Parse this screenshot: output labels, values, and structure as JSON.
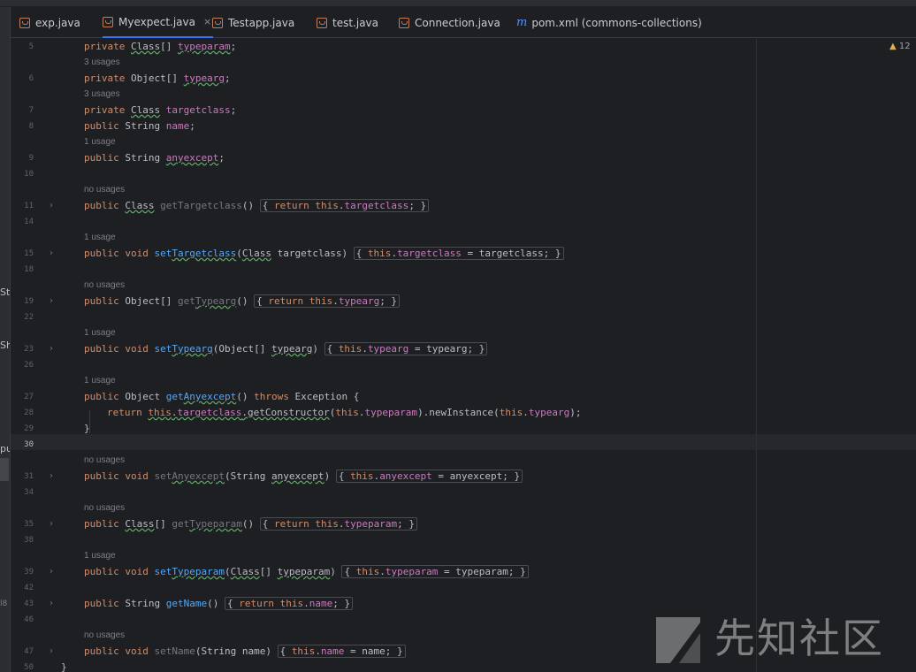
{
  "tabs": [
    {
      "label": "exp.java",
      "icon": "java-file-icon",
      "active": false
    },
    {
      "label": "Myexpect.java",
      "icon": "java-file-icon",
      "active": true,
      "close": "×"
    },
    {
      "label": "Testapp.java",
      "icon": "java-file-icon",
      "active": false
    },
    {
      "label": "test.java",
      "icon": "java-file-icon",
      "active": false
    },
    {
      "label": "Connection.java",
      "icon": "java-file-icon",
      "active": false
    },
    {
      "label": "pom.xml (commons-collections)",
      "icon": "maven-icon",
      "icon_glyph": "m",
      "active": false
    }
  ],
  "left_panel_fragments": [
    "Str",
    "Sh",
    "pu",
    "l8"
  ],
  "inspections": {
    "icon": "warning-icon",
    "count": "12"
  },
  "editor": {
    "current_line": "30",
    "lines": [
      {
        "kind": "code",
        "num": "5",
        "html": "<span class=\"kw\">private</span> <span class=\"ul\">Class</span>[] <span class=\"fld ul\">typeparam</span>;"
      },
      {
        "kind": "hint",
        "text": "3 usages"
      },
      {
        "kind": "code",
        "num": "6",
        "html": "<span class=\"kw\">private</span> Object[] <span class=\"fld ul\">typearg</span>;"
      },
      {
        "kind": "hint",
        "text": "3 usages"
      },
      {
        "kind": "code",
        "num": "7",
        "html": "<span class=\"kw\">private</span> <span class=\"ul\">Class</span> <span class=\"fld\">targetclass</span>;"
      },
      {
        "kind": "code",
        "num": "8",
        "html": "<span class=\"kw\">public</span> String <span class=\"fld\">name</span>;"
      },
      {
        "kind": "hint",
        "text": "1 usage"
      },
      {
        "kind": "code",
        "num": "9",
        "html": "<span class=\"kw\">public</span> String <span class=\"fld ul\">anyexcept</span>;"
      },
      {
        "kind": "code",
        "num": "10",
        "html": ""
      },
      {
        "kind": "hint",
        "text": "no usages"
      },
      {
        "kind": "code",
        "num": "11",
        "fold": "›",
        "html": "<span class=\"kw\">public</span> <span class=\"ul\">Class</span> <span class=\"gmth\">getTargetclass</span>() <span class=\"fb\">{ <span class=\"kw\">return this</span>.<span class=\"fld\">targetclass</span>; }</span>"
      },
      {
        "kind": "code",
        "num": "14",
        "html": ""
      },
      {
        "kind": "hint",
        "text": "1 usage"
      },
      {
        "kind": "code",
        "num": "15",
        "fold": "›",
        "html": "<span class=\"kw\">public void</span> <span class=\"mth\">set<span class=\"ul\">Targetclass</span></span>(<span class=\"ul\">Class</span> targetclass) <span class=\"fb\">{ <span class=\"kw\">this</span>.<span class=\"fld\">targetclass</span> = targetclass; }</span>"
      },
      {
        "kind": "code",
        "num": "18",
        "html": ""
      },
      {
        "kind": "hint",
        "text": "no usages"
      },
      {
        "kind": "code",
        "num": "19",
        "fold": "›",
        "html": "<span class=\"kw\">public</span> Object[] <span class=\"gmth\">get<span class=\"ul\">Typearg</span></span>() <span class=\"fb\">{ <span class=\"kw\">return this</span>.<span class=\"fld\">typearg</span>; }</span>"
      },
      {
        "kind": "code",
        "num": "22",
        "html": ""
      },
      {
        "kind": "hint",
        "text": "1 usage"
      },
      {
        "kind": "code",
        "num": "23",
        "fold": "›",
        "html": "<span class=\"kw\">public void</span> <span class=\"mth\">set<span class=\"ul\">Typearg</span></span>(Object[] <span class=\"ul\">typearg</span>) <span class=\"fb\">{ <span class=\"kw\">this</span>.<span class=\"fld\">typearg</span> = typearg; }</span>"
      },
      {
        "kind": "code",
        "num": "26",
        "html": ""
      },
      {
        "kind": "hint",
        "text": "1 usage"
      },
      {
        "kind": "code",
        "num": "27",
        "html": "<span class=\"kw\">public</span> Object <span class=\"mth\">get<span class=\"ul\">Anyexcept</span></span>() <span class=\"kw\">throws</span> Exception {"
      },
      {
        "kind": "code",
        "num": "28",
        "indent": 2,
        "html": "<span class=\"kw\">return</span> <span class=\"ul\"><span class=\"kw\">this</span>.<span class=\"fld\">targetclass</span>.getConstructor</span>(<span class=\"kw\">this</span>.<span class=\"fld\">typeparam</span>).newInstance(<span class=\"kw\">this</span>.<span class=\"fld\">typearg</span>);"
      },
      {
        "kind": "code",
        "num": "29",
        "html": "}"
      },
      {
        "kind": "code",
        "num": "30",
        "current": true,
        "html": ""
      },
      {
        "kind": "hint",
        "text": "no usages"
      },
      {
        "kind": "code",
        "num": "31",
        "fold": "›",
        "html": "<span class=\"kw\">public void</span> <span class=\"gmth\">set<span class=\"ul\">Anyexcept</span></span>(String <span class=\"ul\">anyexcept</span>) <span class=\"fb\">{ <span class=\"kw\">this</span>.<span class=\"fld\">anyexcept</span> = anyexcept; }</span>"
      },
      {
        "kind": "code",
        "num": "34",
        "html": ""
      },
      {
        "kind": "hint",
        "text": "no usages"
      },
      {
        "kind": "code",
        "num": "35",
        "fold": "›",
        "html": "<span class=\"kw\">public</span> <span class=\"ul\">Class</span>[] <span class=\"gmth\">get<span class=\"ul\">Typeparam</span></span>() <span class=\"fb\">{ <span class=\"kw\">return this</span>.<span class=\"fld\">typeparam</span>; }</span>"
      },
      {
        "kind": "code",
        "num": "38",
        "html": ""
      },
      {
        "kind": "hint",
        "text": "1 usage"
      },
      {
        "kind": "code",
        "num": "39",
        "fold": "›",
        "html": "<span class=\"kw\">public void</span> <span class=\"mth\">set<span class=\"ul\">Typeparam</span></span>(<span class=\"ul\">Class</span>[] <span class=\"ul\">typeparam</span>) <span class=\"fb\">{ <span class=\"kw\">this</span>.<span class=\"fld\">typeparam</span> = typeparam; }</span>"
      },
      {
        "kind": "code",
        "num": "42",
        "html": ""
      },
      {
        "kind": "code",
        "num": "43",
        "fold": "›",
        "html": "<span class=\"kw\">public</span> String <span class=\"mth\">getName</span>() <span class=\"fb\">{ <span class=\"kw\">return this</span>.<span class=\"fld\">name</span>; }</span>"
      },
      {
        "kind": "code",
        "num": "46",
        "html": ""
      },
      {
        "kind": "hint",
        "text": "no usages"
      },
      {
        "kind": "code",
        "num": "47",
        "fold": "›",
        "html": "<span class=\"kw\">public void</span> <span class=\"gmth\">setName</span>(String name) <span class=\"fb\">{ <span class=\"kw\">this</span>.<span class=\"fld\">name</span> = name; }</span>"
      },
      {
        "kind": "code",
        "num": "50",
        "indent": 0,
        "html": "}"
      }
    ]
  },
  "watermark": {
    "text": "先知社区",
    "logo": "xianzhi-logo-icon"
  },
  "colors": {
    "keyword": "#cf8e6d",
    "field": "#c77dbb",
    "method": "#56a8f5",
    "background": "#1e1f22",
    "accent": "#3574f0"
  }
}
